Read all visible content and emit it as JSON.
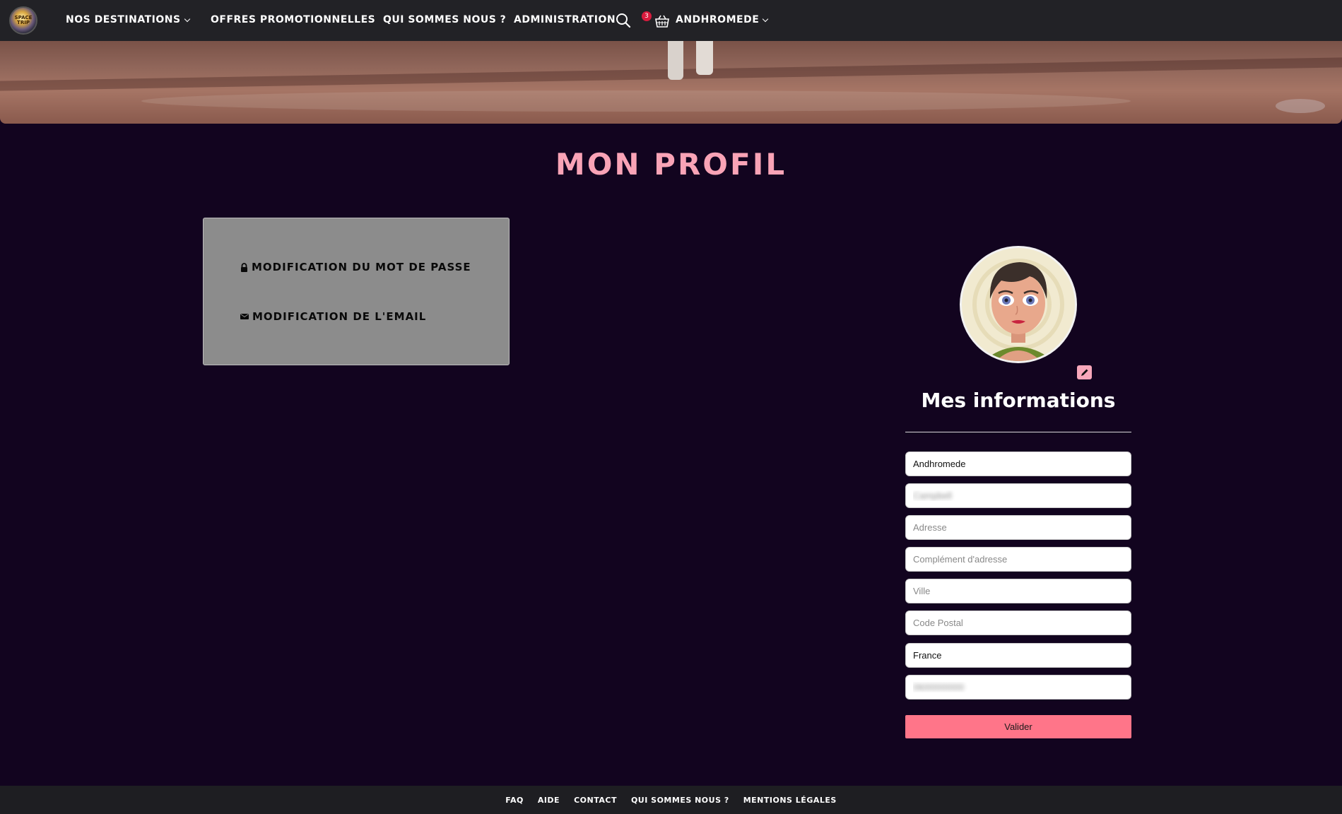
{
  "nav": {
    "logo_text": "SPACE TRIP",
    "destinations_label": "Nos destinations",
    "promos_label": "Offres promotionnelles",
    "about_label": "Qui sommes nous ?",
    "admin_label": "Administration",
    "cart_count": "3",
    "user_label": "Andhromede"
  },
  "page": {
    "title": "Mon profil"
  },
  "account_menu": {
    "password_label": "Modification du mot de passe",
    "email_label": "Modification de l'email"
  },
  "profile": {
    "section_title": "Mes informations",
    "fields": {
      "first_name": {
        "value": "Andhromede",
        "placeholder": ""
      },
      "last_name": {
        "value": "Campbell",
        "placeholder": ""
      },
      "address": {
        "value": "",
        "placeholder": "Adresse"
      },
      "address2": {
        "value": "",
        "placeholder": "Complément d'adresse"
      },
      "city": {
        "value": "",
        "placeholder": "Ville"
      },
      "zip": {
        "value": "",
        "placeholder": "Code Postal"
      },
      "country": {
        "value": "France",
        "placeholder": ""
      },
      "phone": {
        "value": "0600000000",
        "placeholder": ""
      }
    },
    "submit_label": "Valider"
  },
  "footer": {
    "links": [
      "FAQ",
      "Aide",
      "Contact",
      "Qui sommes nous ?",
      "Mentions légales"
    ]
  },
  "colors": {
    "background": "#12041f",
    "navbar": "#222226",
    "title_pink": "#f9a3b6",
    "button_pink": "#ff7589",
    "menu_box": "#8c8c8c",
    "badge_red": "#d81b3d"
  },
  "icons": {
    "search": "search-icon",
    "basket": "basket-icon",
    "lock": "lock-icon",
    "envelope": "envelope-icon",
    "pencil": "pencil-icon"
  }
}
